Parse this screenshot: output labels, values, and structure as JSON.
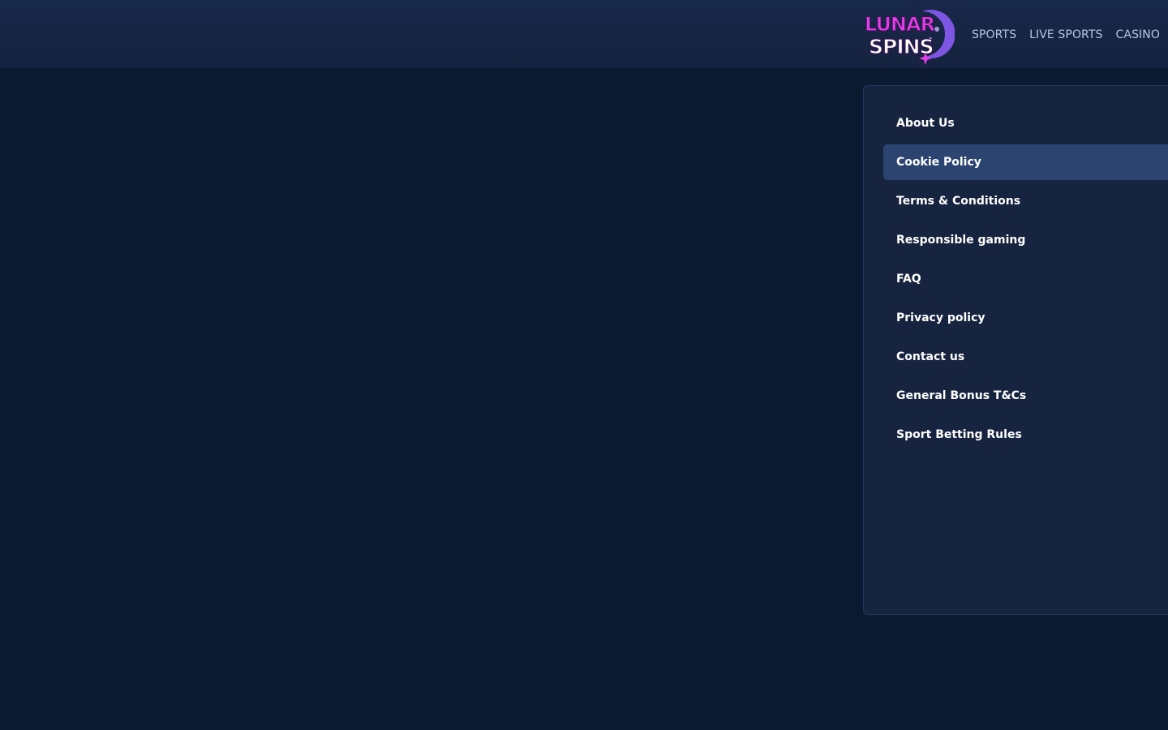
{
  "brand": {
    "logo_line1": "LUNAR",
    "logo_line2": "SPINS",
    "colors": {
      "logo_pink": "#e23ee6",
      "logo_purple": "#8a5cf5",
      "logo_white": "#ffffff",
      "header_bg": "#18284a",
      "page_bg": "#0b1931",
      "panel_bg": "#16243f",
      "active_item_bg": "#2c4570",
      "nav_text": "#b9c6e0"
    }
  },
  "header": {
    "nav": [
      {
        "label": "SPORTS"
      },
      {
        "label": "LIVE SPORTS"
      },
      {
        "label": "CASINO"
      }
    ]
  },
  "sidebar": {
    "selected": "Cookie Policy",
    "items": [
      {
        "label": "About Us"
      },
      {
        "label": "Cookie Policy"
      },
      {
        "label": "Terms & Conditions"
      },
      {
        "label": "Responsible gaming"
      },
      {
        "label": "FAQ"
      },
      {
        "label": "Privacy policy"
      },
      {
        "label": "Contact us"
      },
      {
        "label": "General Bonus T&Cs"
      },
      {
        "label": "Sport Betting Rules"
      }
    ]
  }
}
